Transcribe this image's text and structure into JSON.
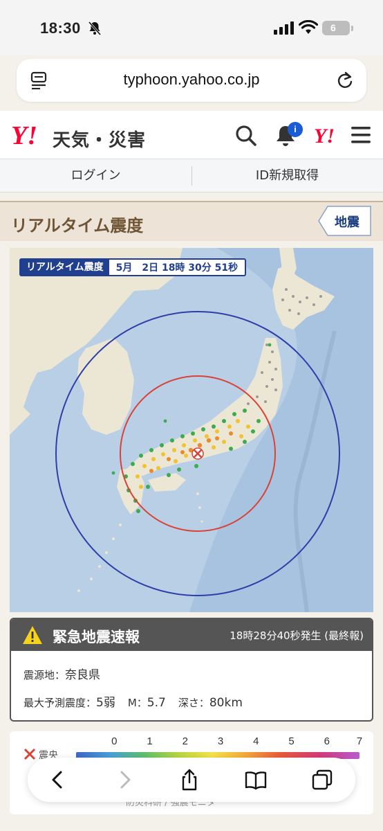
{
  "status_bar": {
    "time": "18:30",
    "battery": "6"
  },
  "browser": {
    "url": "typhoon.yahoo.co.jp"
  },
  "header": {
    "logo": "Y!",
    "service_name": "天気・災害",
    "badge": "i",
    "yahoo_mark": "Y!"
  },
  "account": {
    "login": "ログイン",
    "register": "ID新規取得"
  },
  "section": {
    "title": "リアルタイム震度",
    "quake_tag": "地震"
  },
  "map": {
    "caption_label": "リアルタイム震度",
    "caption_time": "5月　2日 18時 30分 51秒",
    "epicenter_marker": "x-mark-icon",
    "colors": {
      "ring_outer": "#2e3ea8",
      "ring_inner": "#d94236",
      "sea": "#b8cfe6",
      "land": "#ece6d4"
    }
  },
  "eew": {
    "title": "緊急地震速報",
    "issued": "18時28分40秒発生 (最終報)",
    "epicenter_label": "震源地：",
    "epicenter_value": "奈良県",
    "max_intensity_label": "最大予測震度：",
    "max_intensity_value": "5弱",
    "magnitude_label": "M：",
    "magnitude_value": "5.7",
    "depth_label": "深さ：",
    "depth_value": "80km"
  },
  "scale": {
    "legend_label": "震央",
    "ticks": [
      "0",
      "1",
      "2",
      "3",
      "4",
      "5",
      "6",
      "7"
    ],
    "credit": "防災科研 / 強震モニタ"
  },
  "toolbar": {
    "icons": [
      "back-icon",
      "forward-icon",
      "share-icon",
      "bookmarks-icon",
      "tabs-icon"
    ]
  }
}
